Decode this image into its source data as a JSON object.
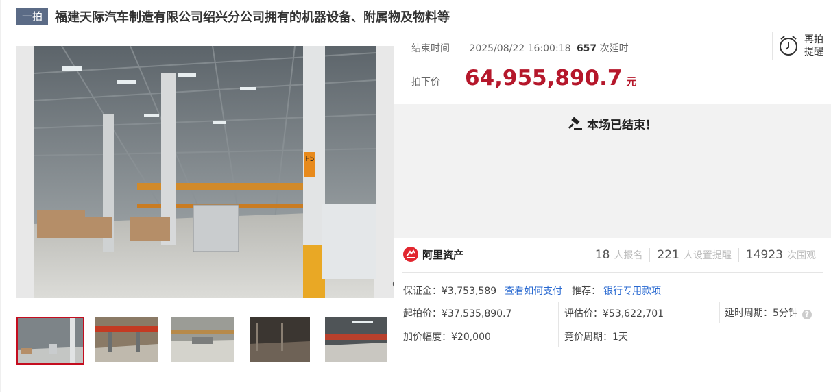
{
  "header": {
    "badge": "一拍",
    "title": "福建天际汽车制造有限公司绍兴分公司拥有的机器设备、附属物及物料等"
  },
  "gallery": {
    "main_image": "warehouse-factory-interior",
    "zoom_icon": "magnifier-icon",
    "pillar_sign": "F5",
    "thumbnails": [
      {
        "name": "factory-hall",
        "selected": true
      },
      {
        "name": "production-line"
      },
      {
        "name": "assembly-floor"
      },
      {
        "name": "dark-workshop"
      },
      {
        "name": "lit-corridor"
      }
    ]
  },
  "auction": {
    "end_label": "结束时间",
    "end_time": "2025/08/22 16:00:18",
    "delay_count": "657",
    "delay_suffix": "次延时",
    "price_label": "拍下价",
    "price": "64,955,890.7",
    "price_unit": "元",
    "remind_label": "再拍提醒",
    "ended_message": "本场已结束！",
    "accent_color": "#b5172b"
  },
  "platform": {
    "name": "阿里资产",
    "stats": [
      {
        "number": "18",
        "label": "人报名"
      },
      {
        "number": "221",
        "label": "人设置提醒"
      },
      {
        "number": "14923",
        "label": "次围观"
      }
    ]
  },
  "details": {
    "deposit": "保证金：¥3,753,589",
    "deposit_link": "查看如何支付",
    "recommend_label": "推荐：",
    "recommend_link": "银行专用款项",
    "start_price": "起拍价：¥37,535,890.7",
    "appraisal": "评估价：¥53,622,701",
    "delay_period": "延时周期：5分钟",
    "increment": "加价幅度：¥20,000",
    "bid_period": "竞价周期：1天"
  }
}
